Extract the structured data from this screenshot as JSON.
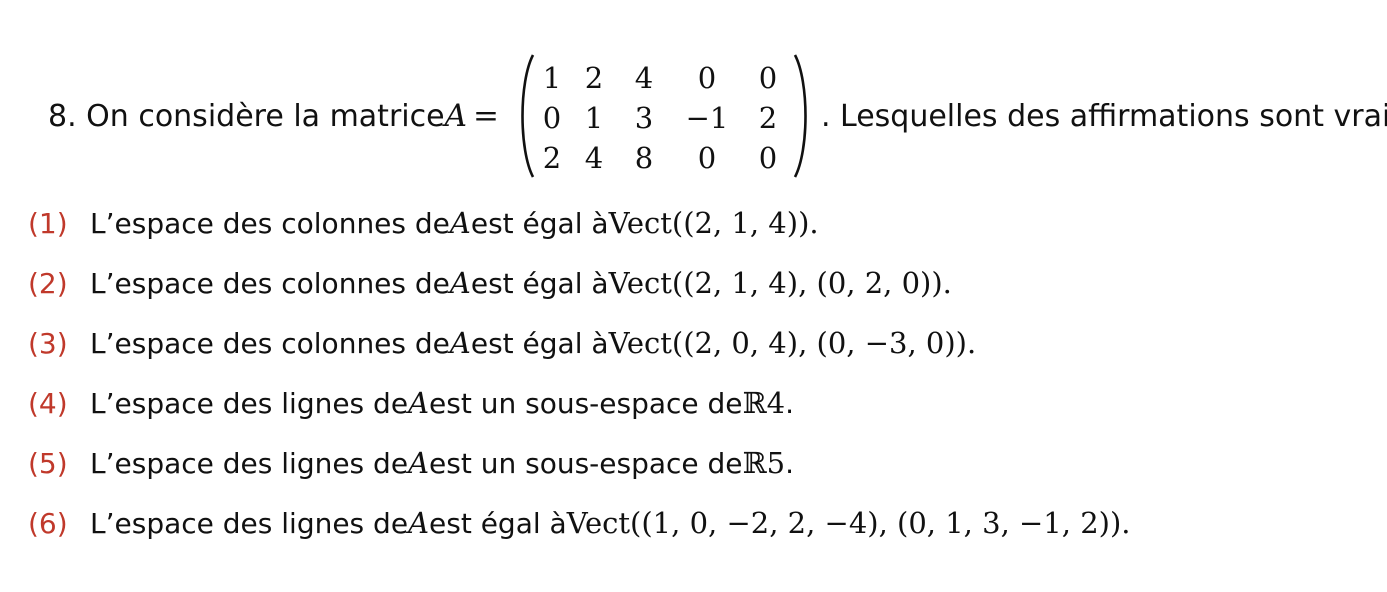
{
  "question": {
    "prefix": "8. On considère la matrice ",
    "var": "A",
    "eq": "=",
    "suffix": ". Lesquelles des affirmations sont vraies :",
    "matrix": [
      [
        "1",
        "2",
        "4",
        "0",
        "0"
      ],
      [
        "0",
        "1",
        "3",
        "−1",
        "2"
      ],
      [
        "2",
        "4",
        "8",
        "0",
        "0"
      ]
    ]
  },
  "options": [
    {
      "num": "(1)",
      "text": "L’espace des colonnes de ",
      "var": "A",
      "mid": " est égal à ",
      "math": "Vect((2, 1, 4)).",
      "sup": ""
    },
    {
      "num": "(2)",
      "text": "L’espace des colonnes de ",
      "var": "A",
      "mid": " est égal à ",
      "math": "Vect((2, 1, 4), (0, 2, 0)).",
      "sup": ""
    },
    {
      "num": "(3)",
      "text": "L’espace des colonnes de ",
      "var": "A",
      "mid": " est égal à ",
      "math": "Vect((2, 0, 4), (0, −3, 0)).",
      "sup": ""
    },
    {
      "num": "(4)",
      "text": "L’espace des lignes de ",
      "var": "A",
      "mid": " est un sous-espace de ",
      "math": "ℝ",
      "sup": "4",
      "after": "."
    },
    {
      "num": "(5)",
      "text": "L’espace des lignes de ",
      "var": "A",
      "mid": " est un sous-espace de ",
      "math": "ℝ",
      "sup": "5",
      "after": "."
    },
    {
      "num": "(6)",
      "text": "L’espace des lignes de ",
      "var": "A",
      "mid": " est égal à ",
      "math": "Vect((1, 0, −2, 2, −4), (0, 1, 3, −1, 2)).",
      "sup": ""
    }
  ],
  "colors": {
    "option_number": "#c0392b",
    "text": "#111111"
  }
}
